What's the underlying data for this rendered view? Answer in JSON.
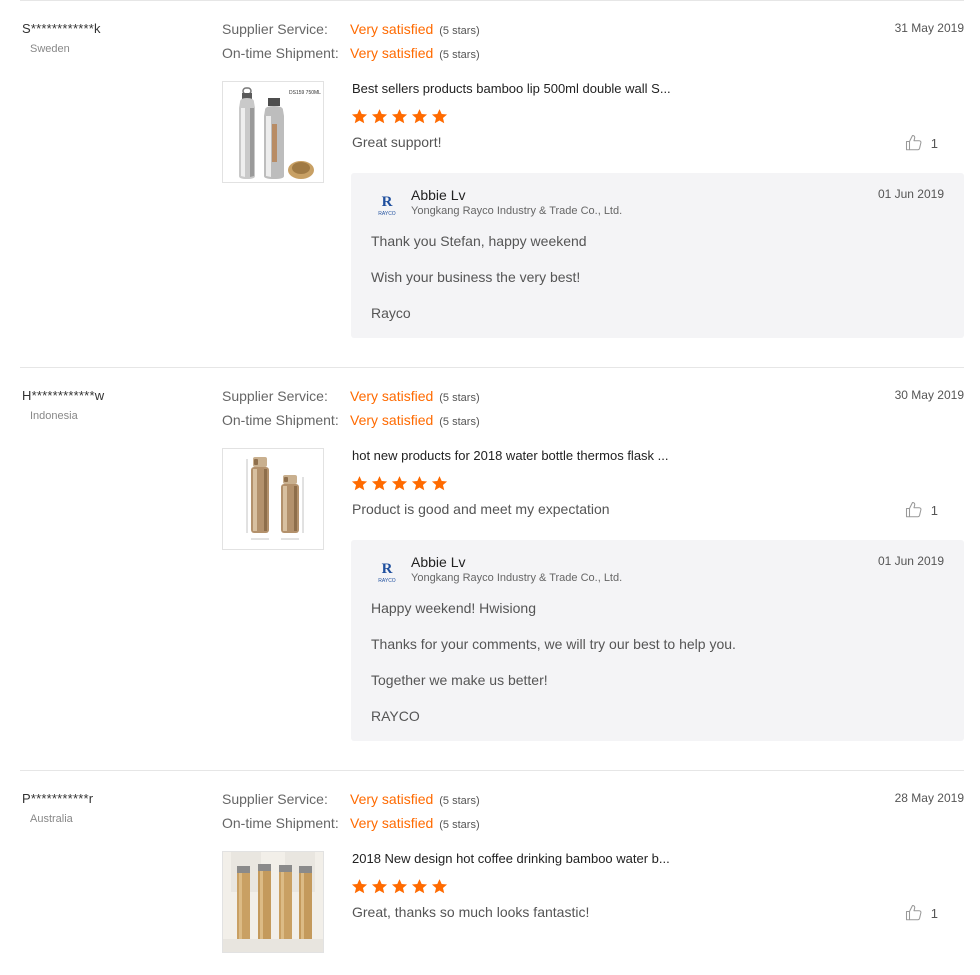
{
  "rating_labels": {
    "supplier_service": "Supplier Service:",
    "ontime_shipment": "On-time Shipment:"
  },
  "reviews": [
    {
      "buyer": "S************k",
      "country": "Sweden",
      "date": "31 May 2019",
      "supplier_service": {
        "value": "Very satisfied",
        "stars_text": "(5 stars)"
      },
      "ontime_shipment": {
        "value": "Very satisfied",
        "stars_text": "(5 stars)"
      },
      "product_title": "Best sellers products bamboo lip 500ml double wall S...",
      "product_image_text": "DS159  750ML",
      "rating": 5,
      "comment": "Great support!",
      "likes": "1",
      "reply": {
        "seller": "Abbie Lv",
        "company": "Yongkang Rayco Industry & Trade Co., Ltd.",
        "date": "01 Jun 2019",
        "lines": [
          "Thank you Stefan, happy weekend",
          "Wish your business the very best!",
          "Rayco"
        ]
      }
    },
    {
      "buyer": "H************w",
      "country": "Indonesia",
      "date": "30 May 2019",
      "supplier_service": {
        "value": "Very satisfied",
        "stars_text": "(5 stars)"
      },
      "ontime_shipment": {
        "value": "Very satisfied",
        "stars_text": "(5 stars)"
      },
      "product_title": "hot new products for 2018 water bottle thermos flask ...",
      "rating": 5,
      "comment": "Product is good and meet my expectation",
      "likes": "1",
      "reply": {
        "seller": "Abbie Lv",
        "company": "Yongkang Rayco Industry & Trade Co., Ltd.",
        "date": "01 Jun 2019",
        "lines": [
          "Happy weekend! Hwisiong",
          "Thanks for your comments, we will try our best to help you.",
          "Together we make us better!",
          "RAYCO"
        ]
      }
    },
    {
      "buyer": "P***********r",
      "country": "Australia",
      "date": "28 May 2019",
      "supplier_service": {
        "value": "Very satisfied",
        "stars_text": "(5 stars)"
      },
      "ontime_shipment": {
        "value": "Very satisfied",
        "stars_text": "(5 stars)"
      },
      "product_title": "2018 New design hot coffee drinking bamboo water b...",
      "rating": 5,
      "comment": "Great, thanks so much looks fantastic!",
      "likes": "1"
    }
  ],
  "seller_logo_text": "RAYCO",
  "colors": {
    "accent": "#ff6a00",
    "reply_bg": "#f4f4f6",
    "divider": "#e6e6e6"
  },
  "icons": {
    "like": "thumbs-up-icon",
    "star": "star-icon"
  }
}
